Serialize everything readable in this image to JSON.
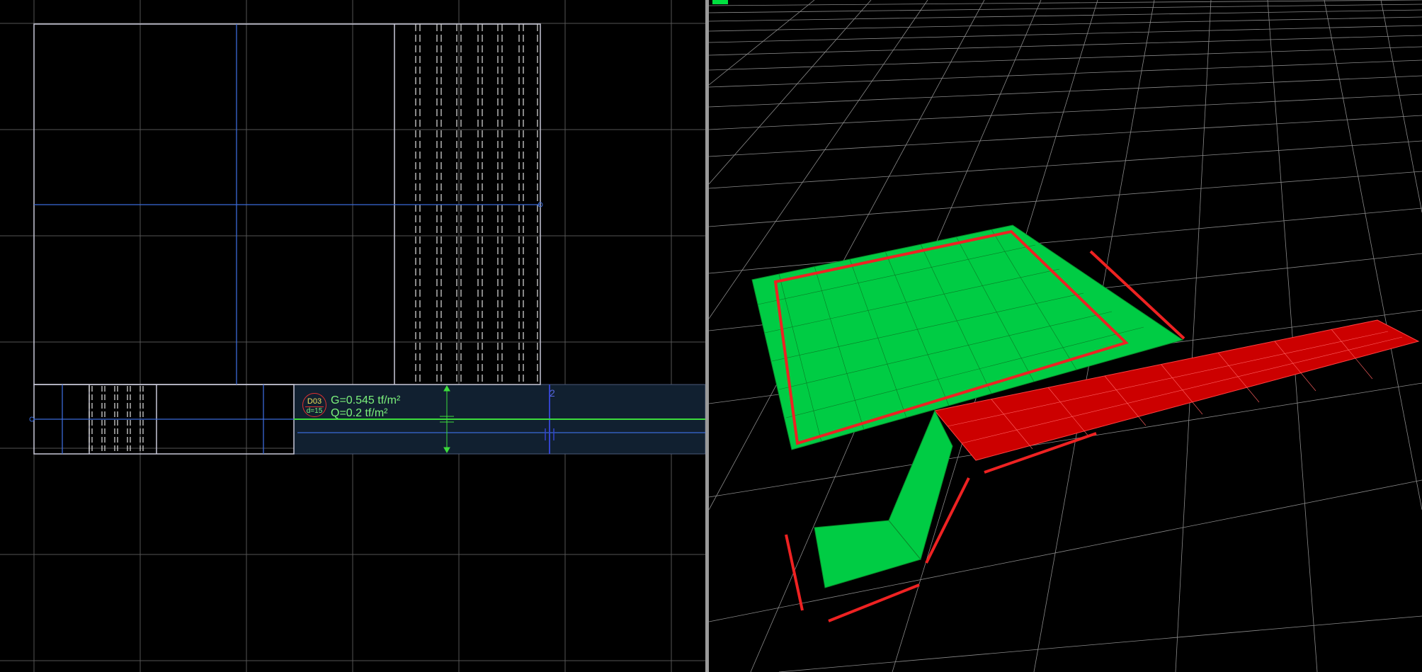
{
  "plan_view": {
    "slab_label": {
      "id": "D03",
      "thickness": "d=15",
      "dead_load": "G=0.545 tf/m²",
      "live_load": "Q=0.2 tf/m²"
    },
    "axis_number": "2"
  },
  "view_3d": {
    "colors": {
      "selected_slab": "#00cc44",
      "highlight_edges": "#ee2222",
      "other_slab": "#cc0000",
      "grid": "#bbbbbb"
    }
  },
  "icons": {
    "status_indicator": "green-status-indicator",
    "slab_tag": "circle-tag"
  }
}
